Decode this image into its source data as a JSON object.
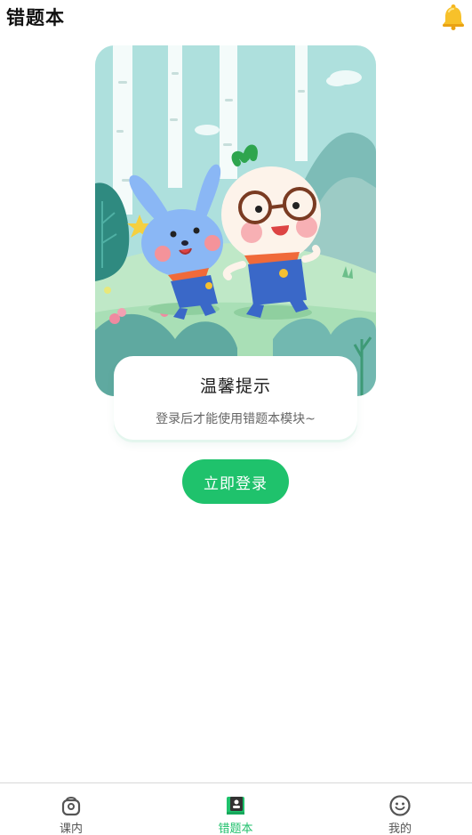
{
  "header": {
    "title": "错题本"
  },
  "tip": {
    "title": "温馨提示",
    "message": "登录后才能使用错题本模块~"
  },
  "actions": {
    "login_label": "立即登录"
  },
  "tabbar": {
    "items": [
      {
        "label": "课内",
        "icon": "backpack-icon",
        "active": false
      },
      {
        "label": "错题本",
        "icon": "notebook-icon",
        "active": true
      },
      {
        "label": "我的",
        "icon": "smiley-icon",
        "active": false
      }
    ]
  },
  "colors": {
    "accent": "#1fc26c",
    "bell": "#f5b51c",
    "inactive_tab": "#555555"
  }
}
